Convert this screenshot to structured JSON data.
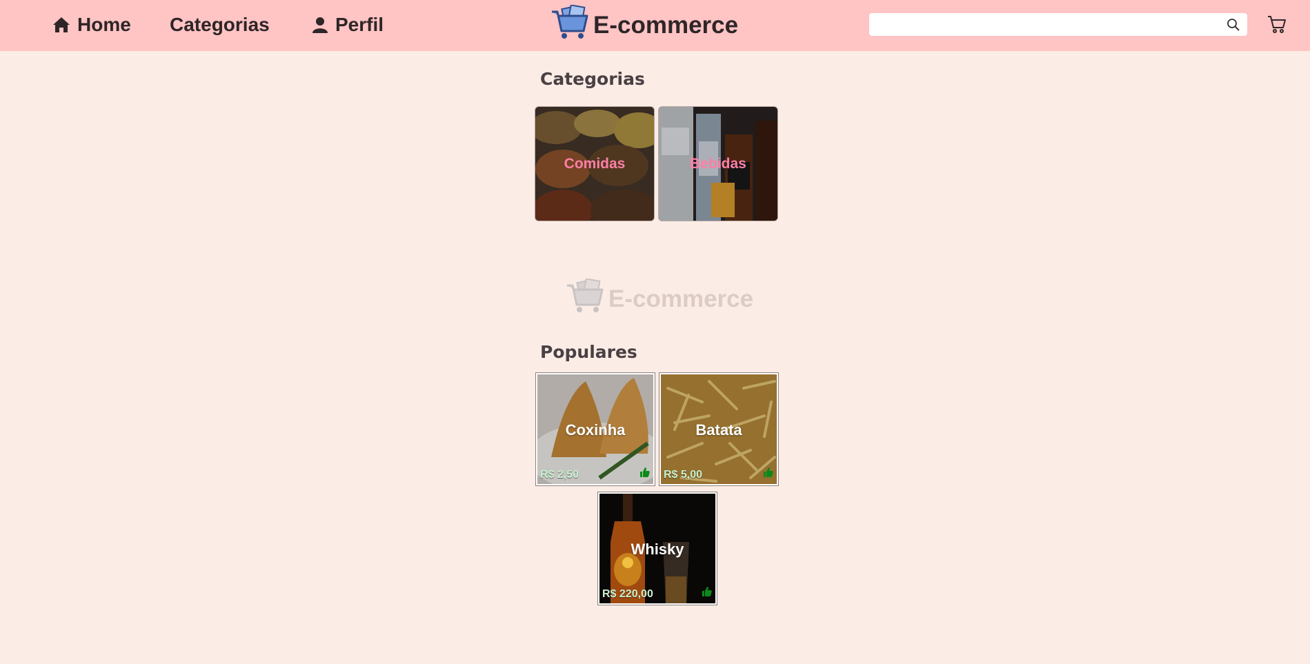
{
  "header": {
    "nav": {
      "home": "Home",
      "categorias": "Categorias",
      "perfil": "Perfil"
    },
    "brand": "E-commerce",
    "search": {
      "value": "",
      "placeholder": ""
    }
  },
  "main": {
    "categorias_title": "Categorias",
    "categories": [
      {
        "label": "Comidas"
      },
      {
        "label": "Bebidas"
      }
    ],
    "watermark": "E-commerce",
    "populares_title": "Populares",
    "products": [
      {
        "name": "Coxinha",
        "price": "R$ 2,50"
      },
      {
        "name": "Batata",
        "price": "R$ 5,00"
      },
      {
        "name": "Whisky",
        "price": "R$ 220,00"
      }
    ]
  },
  "colors": {
    "header_bg": "#ffc4c4",
    "page_bg": "#fbede5",
    "category_label": "#ff7fa6",
    "price_text": "#c8f0d0",
    "like_icon": "#0a8a1a"
  },
  "icons": [
    "home-icon",
    "user-icon",
    "cart-logo-icon",
    "search-icon",
    "cart-icon",
    "thumbs-up-icon"
  ]
}
